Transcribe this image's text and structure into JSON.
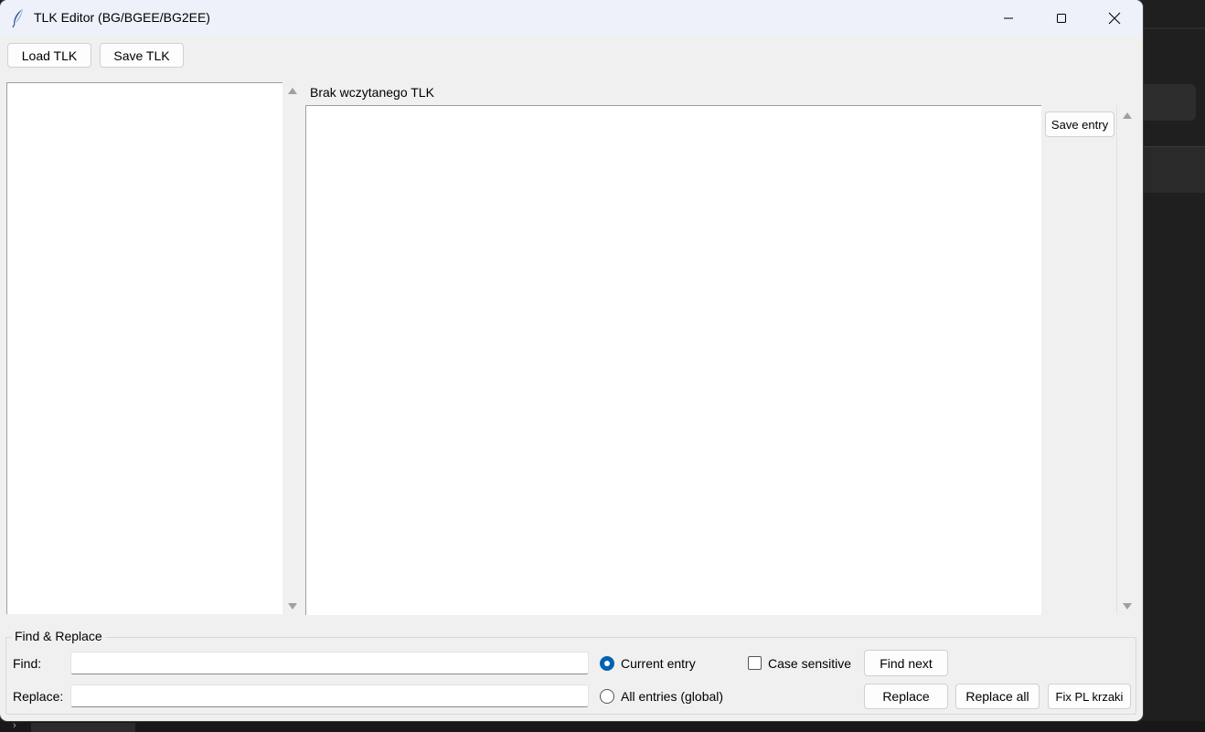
{
  "window": {
    "title": "TLK Editor (BG/BGEE/BG2EE)",
    "icon": "feather-icon"
  },
  "toolbar": {
    "load_label": "Load TLK",
    "save_label": "Save TLK"
  },
  "editor": {
    "status_text": "Brak wczytanego TLK",
    "save_entry_label": "Save entry"
  },
  "find_replace": {
    "group_title": "Find & Replace",
    "find_label": "Find:",
    "find_value": "",
    "replace_label": "Replace:",
    "replace_value": "",
    "scope_current_label": "Current entry",
    "scope_current_selected": true,
    "scope_all_label": "All entries (global)",
    "case_sensitive_label": "Case sensitive",
    "case_sensitive_checked": false,
    "find_next_label": "Find next",
    "replace_label_btn": "Replace",
    "replace_all_label": "Replace all",
    "fix_pl_label": "Fix PL krzaki"
  },
  "colors": {
    "accent": "#0063b1",
    "titlebar": "#eef1f9",
    "window_bg": "#f0f0f0"
  }
}
